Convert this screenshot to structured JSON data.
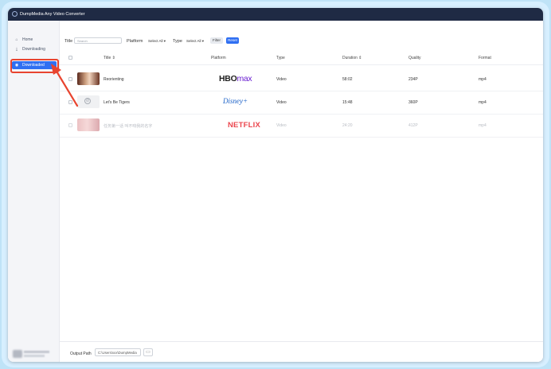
{
  "app": {
    "title": "DumpMedia Any Video Converter"
  },
  "sidebar": {
    "items": [
      {
        "label": "Home",
        "icon": "home-icon"
      },
      {
        "label": "Downloading",
        "icon": "download-icon"
      },
      {
        "label": "Downloaded",
        "icon": "check-circle-icon",
        "active": true
      }
    ]
  },
  "toolbar": {
    "title_label": "Title",
    "search_placeholder": "Search",
    "platform_label": "Platform",
    "platform_value": "Select All",
    "type_label": "Type",
    "type_value": "Select All",
    "filter_label": "Filter",
    "reset_label": "Reset"
  },
  "table": {
    "columns": [
      "Title",
      "Platform",
      "Type",
      "Duration",
      "Quality",
      "Format"
    ],
    "rows": [
      {
        "title": "Reorienting",
        "platform": "HBOmax",
        "type": "Video",
        "duration": "58:02",
        "quality": "234P",
        "format": "mp4"
      },
      {
        "title": "Let's Be Tigers",
        "platform": "Disney",
        "type": "Video",
        "duration": "15:48",
        "quality": "360P",
        "format": "mp4"
      },
      {
        "title": "任务第一话 叫不响我的名字",
        "platform": "NETFLIX",
        "type": "Video",
        "duration": "24:20",
        "quality": "412P",
        "format": "mp4"
      }
    ]
  },
  "footer": {
    "output_label": "Output Path",
    "output_path": "C:\\Users\\xxx\\DumpMedia"
  },
  "colors": {
    "accent": "#2f6ff2",
    "titlebar": "#1f2a44",
    "highlight": "#e8442f"
  }
}
